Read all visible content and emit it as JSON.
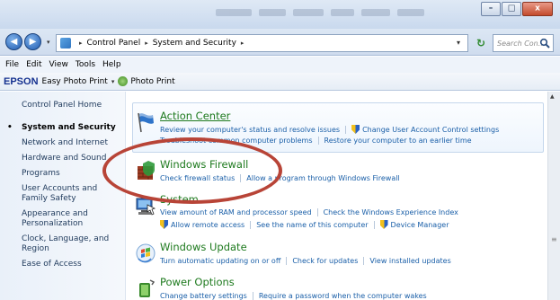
{
  "window": {
    "min_glyph": "–",
    "max_glyph": "□",
    "close_glyph": "x"
  },
  "address": {
    "back_glyph": "◀",
    "forward_glyph": "▶",
    "crumbs": [
      "Control Panel",
      "System and Security"
    ],
    "separator": "▸",
    "dropdown_glyph": "▾",
    "refresh_glyph": "↻",
    "search_placeholder": "Search Con..."
  },
  "menu": [
    "File",
    "Edit",
    "View",
    "Tools",
    "Help"
  ],
  "epson": {
    "logo": "EPSON",
    "item1": "Easy Photo Print",
    "item2": "Photo Print",
    "dropdown_glyph": "▾"
  },
  "sidebar": {
    "home": "Control Panel Home",
    "items": [
      {
        "label": "System and Security",
        "current": true
      },
      {
        "label": "Network and Internet"
      },
      {
        "label": "Hardware and Sound"
      },
      {
        "label": "Programs"
      },
      {
        "label": "User Accounts and Family Safety"
      },
      {
        "label": "Appearance and Personalization"
      },
      {
        "label": "Clock, Language, and Region"
      },
      {
        "label": "Ease of Access"
      }
    ]
  },
  "categories": [
    {
      "title": "Action Center",
      "icon": "flag-icon",
      "rows": [
        [
          "Review your computer's status and resolve issues",
          "Change User Account Control settings"
        ],
        [
          "Troubleshoot common computer problems",
          "Restore your computer to an earlier time"
        ]
      ]
    },
    {
      "title": "Windows Firewall",
      "icon": "firewall-icon",
      "rows": [
        [
          "Check firewall status",
          "Allow a program through Windows Firewall"
        ]
      ]
    },
    {
      "title": "System",
      "icon": "computer-icon",
      "rows": [
        [
          "View amount of RAM and processor speed",
          "Check the Windows Experience Index"
        ],
        [
          "Allow remote access",
          "See the name of this computer",
          "Device Manager"
        ]
      ]
    },
    {
      "title": "Windows Update",
      "icon": "windows-update-icon",
      "rows": [
        [
          "Turn automatic updating on or off",
          "Check for updates",
          "View installed updates"
        ]
      ]
    },
    {
      "title": "Power Options",
      "icon": "power-options-icon",
      "rows": [
        [
          "Change battery settings",
          "Require a password when the computer wakes"
        ]
      ]
    }
  ],
  "colors": {
    "annotation": "#b84437",
    "category_title": "#1e7a1e",
    "link": "#1a5fa8"
  }
}
